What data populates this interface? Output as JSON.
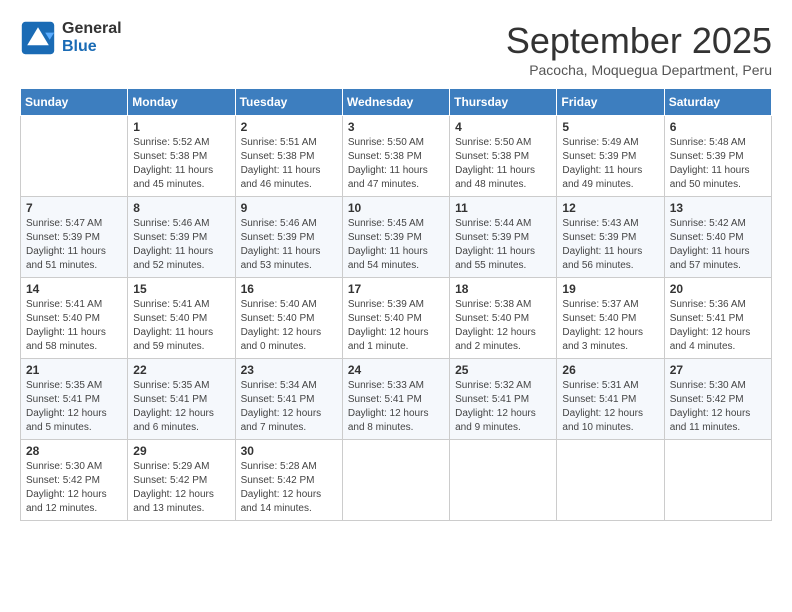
{
  "logo": {
    "line1": "General",
    "line2": "Blue"
  },
  "title": "September 2025",
  "subtitle": "Pacocha, Moquegua Department, Peru",
  "days_header": [
    "Sunday",
    "Monday",
    "Tuesday",
    "Wednesday",
    "Thursday",
    "Friday",
    "Saturday"
  ],
  "weeks": [
    [
      {
        "day": "",
        "info": ""
      },
      {
        "day": "1",
        "info": "Sunrise: 5:52 AM\nSunset: 5:38 PM\nDaylight: 11 hours\nand 45 minutes."
      },
      {
        "day": "2",
        "info": "Sunrise: 5:51 AM\nSunset: 5:38 PM\nDaylight: 11 hours\nand 46 minutes."
      },
      {
        "day": "3",
        "info": "Sunrise: 5:50 AM\nSunset: 5:38 PM\nDaylight: 11 hours\nand 47 minutes."
      },
      {
        "day": "4",
        "info": "Sunrise: 5:50 AM\nSunset: 5:38 PM\nDaylight: 11 hours\nand 48 minutes."
      },
      {
        "day": "5",
        "info": "Sunrise: 5:49 AM\nSunset: 5:39 PM\nDaylight: 11 hours\nand 49 minutes."
      },
      {
        "day": "6",
        "info": "Sunrise: 5:48 AM\nSunset: 5:39 PM\nDaylight: 11 hours\nand 50 minutes."
      }
    ],
    [
      {
        "day": "7",
        "info": "Sunrise: 5:47 AM\nSunset: 5:39 PM\nDaylight: 11 hours\nand 51 minutes."
      },
      {
        "day": "8",
        "info": "Sunrise: 5:46 AM\nSunset: 5:39 PM\nDaylight: 11 hours\nand 52 minutes."
      },
      {
        "day": "9",
        "info": "Sunrise: 5:46 AM\nSunset: 5:39 PM\nDaylight: 11 hours\nand 53 minutes."
      },
      {
        "day": "10",
        "info": "Sunrise: 5:45 AM\nSunset: 5:39 PM\nDaylight: 11 hours\nand 54 minutes."
      },
      {
        "day": "11",
        "info": "Sunrise: 5:44 AM\nSunset: 5:39 PM\nDaylight: 11 hours\nand 55 minutes."
      },
      {
        "day": "12",
        "info": "Sunrise: 5:43 AM\nSunset: 5:39 PM\nDaylight: 11 hours\nand 56 minutes."
      },
      {
        "day": "13",
        "info": "Sunrise: 5:42 AM\nSunset: 5:40 PM\nDaylight: 11 hours\nand 57 minutes."
      }
    ],
    [
      {
        "day": "14",
        "info": "Sunrise: 5:41 AM\nSunset: 5:40 PM\nDaylight: 11 hours\nand 58 minutes."
      },
      {
        "day": "15",
        "info": "Sunrise: 5:41 AM\nSunset: 5:40 PM\nDaylight: 11 hours\nand 59 minutes."
      },
      {
        "day": "16",
        "info": "Sunrise: 5:40 AM\nSunset: 5:40 PM\nDaylight: 12 hours\nand 0 minutes."
      },
      {
        "day": "17",
        "info": "Sunrise: 5:39 AM\nSunset: 5:40 PM\nDaylight: 12 hours\nand 1 minute."
      },
      {
        "day": "18",
        "info": "Sunrise: 5:38 AM\nSunset: 5:40 PM\nDaylight: 12 hours\nand 2 minutes."
      },
      {
        "day": "19",
        "info": "Sunrise: 5:37 AM\nSunset: 5:40 PM\nDaylight: 12 hours\nand 3 minutes."
      },
      {
        "day": "20",
        "info": "Sunrise: 5:36 AM\nSunset: 5:41 PM\nDaylight: 12 hours\nand 4 minutes."
      }
    ],
    [
      {
        "day": "21",
        "info": "Sunrise: 5:35 AM\nSunset: 5:41 PM\nDaylight: 12 hours\nand 5 minutes."
      },
      {
        "day": "22",
        "info": "Sunrise: 5:35 AM\nSunset: 5:41 PM\nDaylight: 12 hours\nand 6 minutes."
      },
      {
        "day": "23",
        "info": "Sunrise: 5:34 AM\nSunset: 5:41 PM\nDaylight: 12 hours\nand 7 minutes."
      },
      {
        "day": "24",
        "info": "Sunrise: 5:33 AM\nSunset: 5:41 PM\nDaylight: 12 hours\nand 8 minutes."
      },
      {
        "day": "25",
        "info": "Sunrise: 5:32 AM\nSunset: 5:41 PM\nDaylight: 12 hours\nand 9 minutes."
      },
      {
        "day": "26",
        "info": "Sunrise: 5:31 AM\nSunset: 5:41 PM\nDaylight: 12 hours\nand 10 minutes."
      },
      {
        "day": "27",
        "info": "Sunrise: 5:30 AM\nSunset: 5:42 PM\nDaylight: 12 hours\nand 11 minutes."
      }
    ],
    [
      {
        "day": "28",
        "info": "Sunrise: 5:30 AM\nSunset: 5:42 PM\nDaylight: 12 hours\nand 12 minutes."
      },
      {
        "day": "29",
        "info": "Sunrise: 5:29 AM\nSunset: 5:42 PM\nDaylight: 12 hours\nand 13 minutes."
      },
      {
        "day": "30",
        "info": "Sunrise: 5:28 AM\nSunset: 5:42 PM\nDaylight: 12 hours\nand 14 minutes."
      },
      {
        "day": "",
        "info": ""
      },
      {
        "day": "",
        "info": ""
      },
      {
        "day": "",
        "info": ""
      },
      {
        "day": "",
        "info": ""
      }
    ]
  ]
}
